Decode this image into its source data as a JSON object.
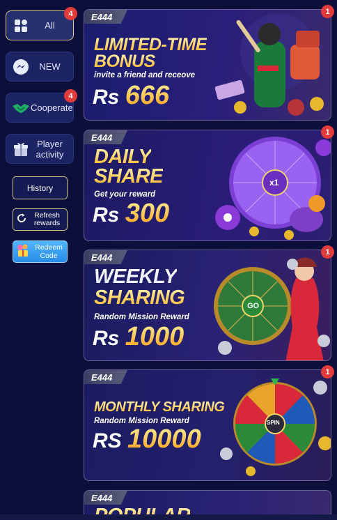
{
  "sidebar": {
    "categories": [
      {
        "label": "All",
        "badge": "4",
        "icon": "grid-icon"
      },
      {
        "label": "NEW",
        "icon": "messenger-icon"
      },
      {
        "label": "Cooperate",
        "badge": "4",
        "icon": "handshake-icon"
      },
      {
        "label": "Player activity",
        "icon": "gift-icon"
      }
    ],
    "history_label": "History",
    "refresh_label": "Refresh rewards",
    "redeem_label": "Redeem Code"
  },
  "cards": [
    {
      "brand": "E444",
      "line1": "LIMITED-TIME",
      "line2": "BONUS",
      "sub": "invite a friend and receove",
      "currency": "Rs",
      "amount": "666",
      "badge": "1"
    },
    {
      "brand": "E444",
      "line1": "DAILY",
      "line2": "SHARE",
      "sub": "Get your reward",
      "currency": "Rs",
      "amount": "300",
      "badge": "1"
    },
    {
      "brand": "E444",
      "line1": "WEEKLY",
      "line2": "SHARING",
      "sub": "Random Mission Reward",
      "currency": "Rs",
      "amount": "1000",
      "badge": "1"
    },
    {
      "brand": "E444",
      "line1": "MONTHLY SHARING",
      "line2": "",
      "sub": "Random Mission Reward",
      "currency": "RS",
      "amount": "10000",
      "badge": "1"
    },
    {
      "brand": "E444",
      "line1": "POPULAR",
      "line2": "",
      "sub": "",
      "currency": "",
      "amount": "",
      "badge": ""
    }
  ],
  "wheel_labels": {
    "x1": "x1",
    "go": "GO",
    "spin": "SPIN"
  },
  "colors": {
    "background": "#0b0f3a",
    "badge": "#e23b3b",
    "gold": "#ffb21f",
    "active_border": "#d8c98a"
  }
}
